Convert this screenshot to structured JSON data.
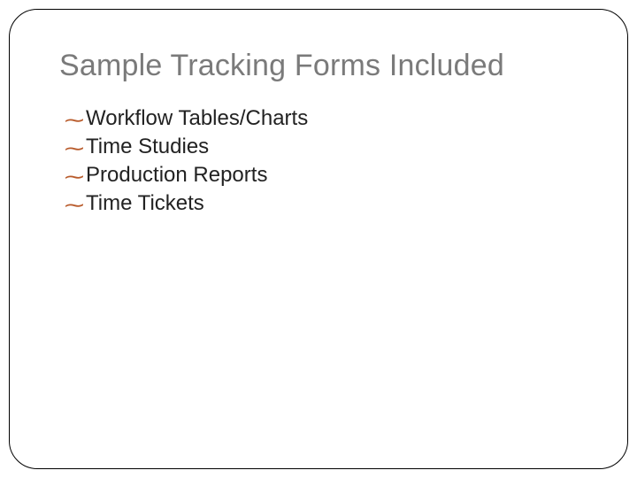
{
  "slide": {
    "title": "Sample Tracking Forms Included",
    "items": [
      {
        "label": "Workflow  Tables/Charts"
      },
      {
        "label": "Time Studies"
      },
      {
        "label": "Production Reports"
      },
      {
        "label": "Time Tickets"
      }
    ],
    "bullet_glyph": ""
  }
}
